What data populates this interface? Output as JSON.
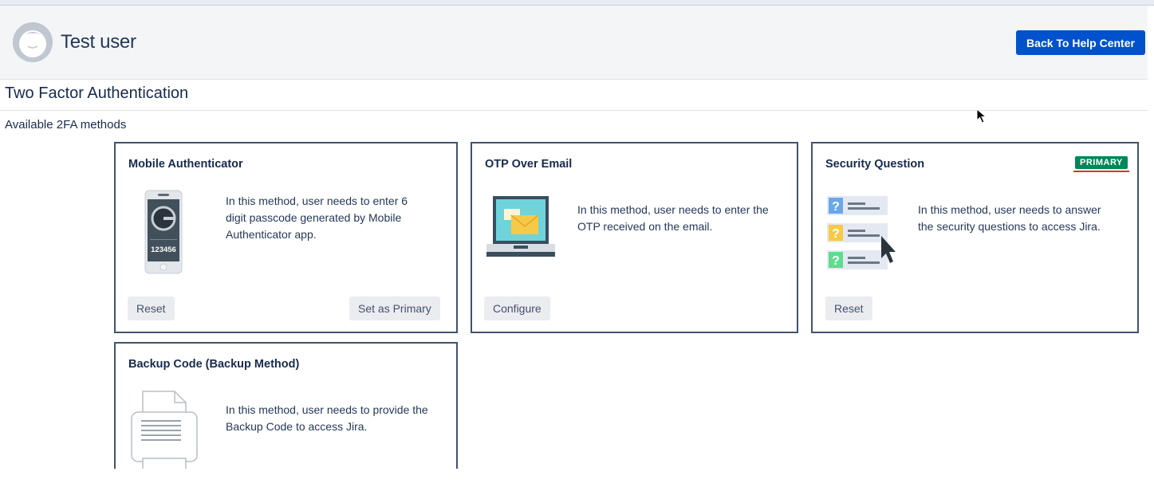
{
  "header": {
    "user_name": "Test user",
    "back_button_label": "Back To Help Center",
    "avatar_icon": "user-avatar-icon"
  },
  "page": {
    "title": "Two Factor Authentication",
    "subtitle": "Available 2FA methods"
  },
  "methods": [
    {
      "title": "Mobile Authenticator",
      "description": "In this method, user needs to enter 6 digit passcode generated by Mobile Authenticator app.",
      "desc_lines": [
        "In this method, user needs to enter 6",
        "digit passcode generated by Mobile",
        "Authenticator app."
      ],
      "icon": "mobile-authenticator-icon",
      "phone_code": "123456",
      "buttons": [
        "Reset",
        "Set as Primary"
      ]
    },
    {
      "title": "OTP Over Email",
      "description": "In this method, user needs to enter the OTP received on the email.",
      "desc_lines": [
        "In this method, user needs to enter the",
        "OTP received on the email."
      ],
      "icon": "email-laptop-icon",
      "buttons": [
        "Configure"
      ]
    },
    {
      "title": "Security Question",
      "description": "In this method, user needs to answer the security questions to access Jira.",
      "desc_lines": [
        "In this method, user needs to answer",
        "the security questions to access Jira."
      ],
      "icon": "security-question-icon",
      "badge": "PRIMARY",
      "buttons": [
        "Reset"
      ]
    },
    {
      "title": "Backup Code (Backup Method)",
      "description": "In this method, user needs to provide the Backup Code to access Jira.",
      "desc_lines": [
        "In this method, user needs to provide the",
        "Backup Code to access Jira."
      ],
      "icon": "backup-code-document-icon",
      "buttons": []
    }
  ],
  "colors": {
    "primary_button": "#0052cc",
    "badge": "#00875a",
    "badge_underline": "#de350b",
    "card_border": "#42526e"
  }
}
